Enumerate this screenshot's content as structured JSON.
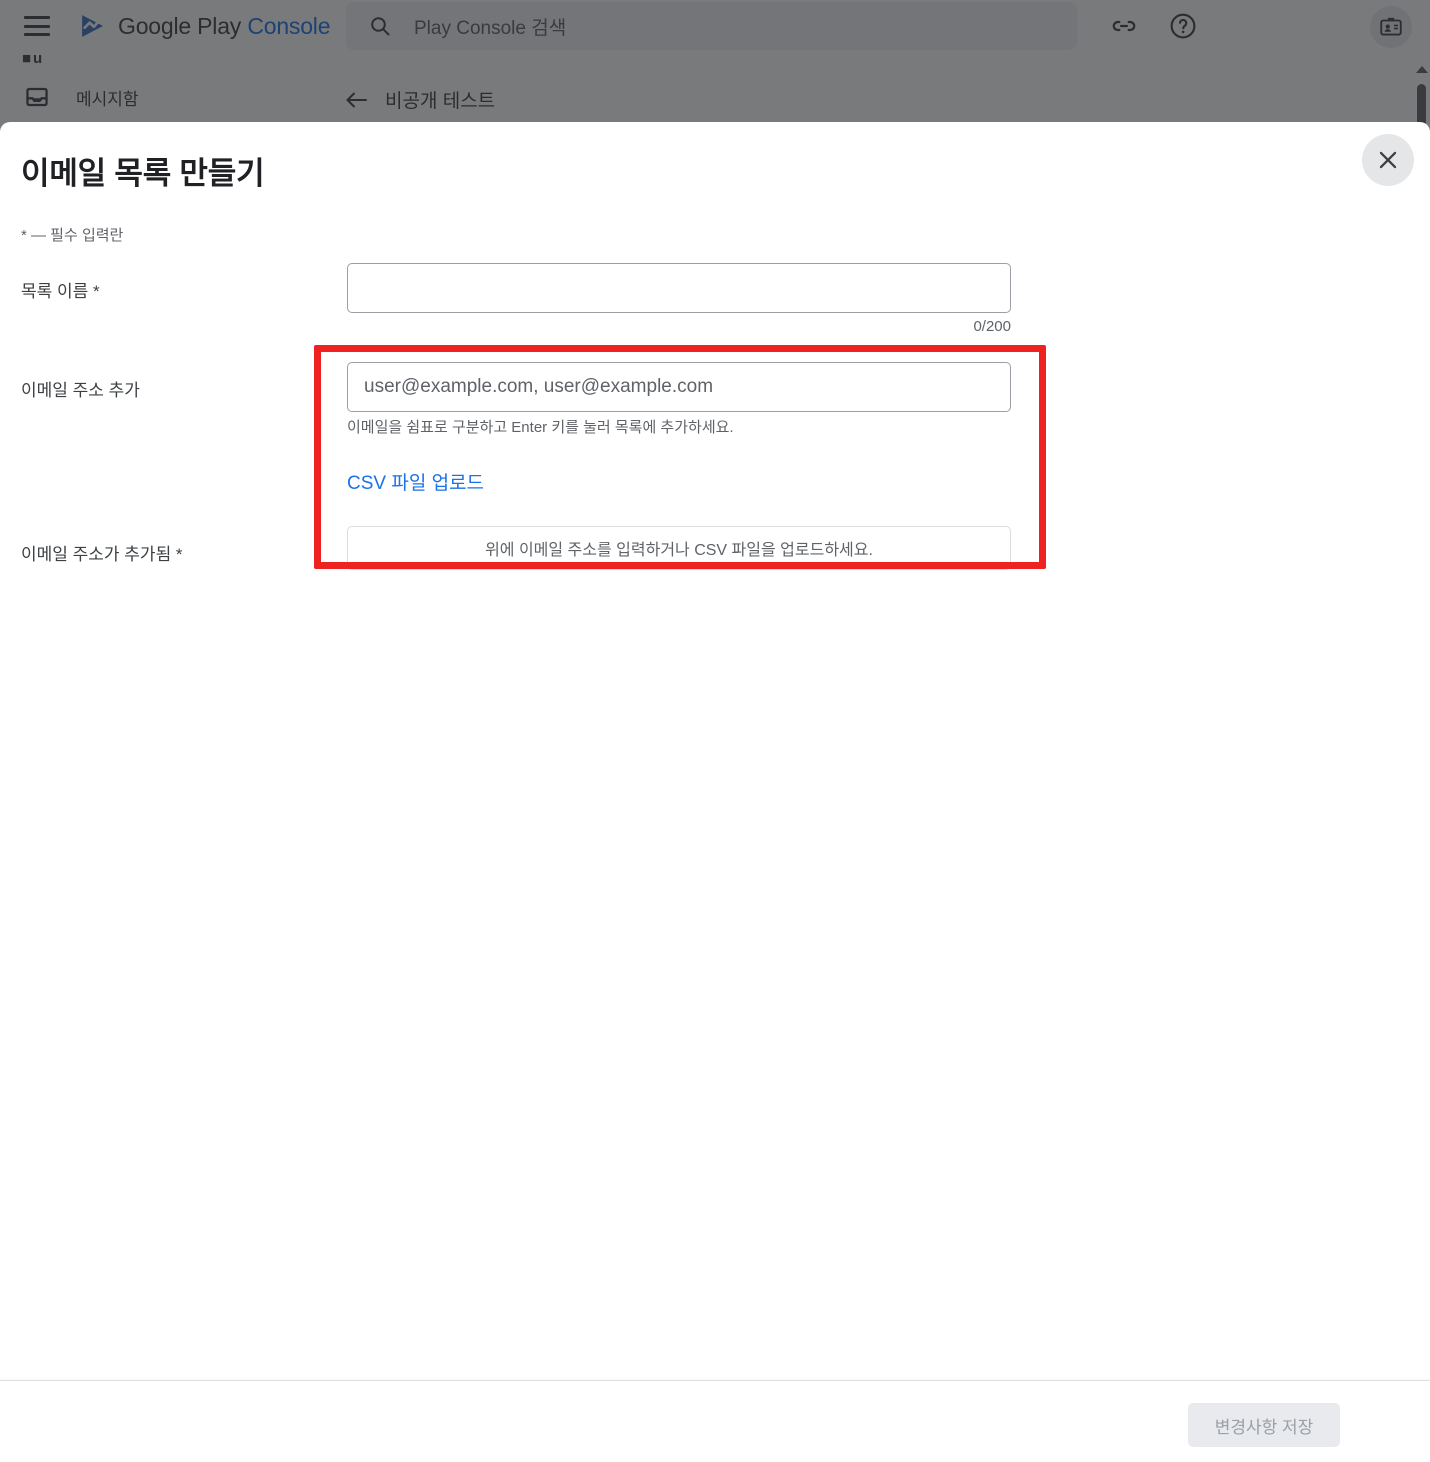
{
  "app": {
    "brand_primary": "Google Play",
    "brand_secondary": "Console",
    "brand_accent_color": "#1a73e8",
    "menu_icon": "hamburger-menu-icon",
    "logo_icon": "google-play-logo-icon"
  },
  "search": {
    "placeholder": "Play Console 검색",
    "icon": "search-icon"
  },
  "header_actions": {
    "link_icon": "link-icon",
    "help_icon": "help-circle-icon",
    "account_icon": "account-badge-icon"
  },
  "sidebar": {
    "items": [
      {
        "label": "메시지함",
        "icon": "inbox-icon"
      }
    ],
    "partial_fragment": "■u"
  },
  "breadcrumb": {
    "back_icon": "arrow-left-icon",
    "label": "비공개 테스트"
  },
  "dialog": {
    "title": "이메일 목록 만들기",
    "close_icon": "close-x-icon",
    "required_note": "* — 필수 입력란",
    "fields": {
      "list_name": {
        "label": "목록 이름  *",
        "value": "",
        "placeholder": "",
        "counter": "0/200"
      },
      "add_emails": {
        "label": "이메일 주소 추가",
        "value": "",
        "placeholder": "user@example.com, user@example.com",
        "helper": "이메일을 쉼표로 구분하고 Enter 키를 눌러 목록에 추가하세요."
      },
      "csv_upload_link": "CSV 파일 업로드",
      "emails_added": {
        "label": "이메일 주소가 추가됨  *",
        "empty_state": "위에 이메일 주소를 입력하거나 CSV 파일을 업로드하세요."
      }
    },
    "footer": {
      "save_label": "변경사항 저장",
      "save_disabled": true
    }
  },
  "annotation": {
    "highlight_color": "#ef2222",
    "shape": "rectangle"
  },
  "scrollbar": {
    "up_arrow_icon": "scroll-up-arrow-icon",
    "thumb": "scrollbar-thumb"
  }
}
